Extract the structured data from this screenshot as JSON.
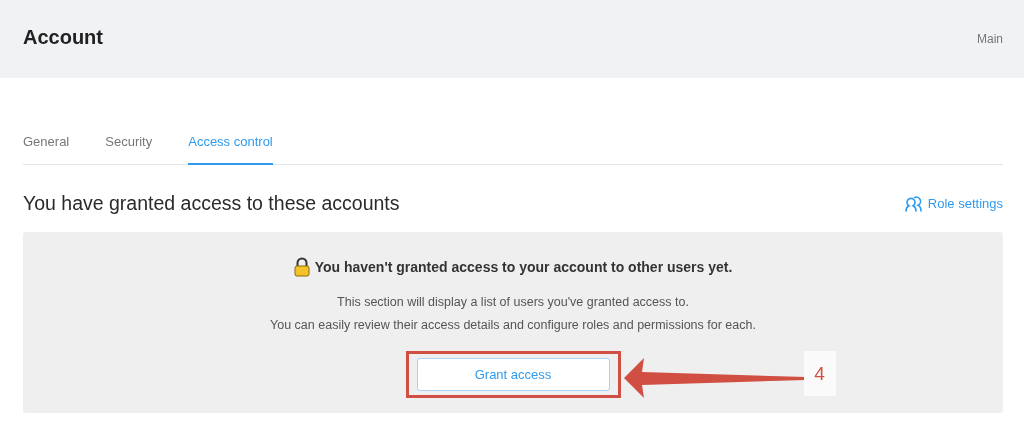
{
  "header": {
    "title": "Account",
    "breadcrumb": "Main"
  },
  "tabs": [
    {
      "label": "General",
      "selected": false
    },
    {
      "label": "Security",
      "selected": false
    },
    {
      "label": "Access control",
      "selected": true
    }
  ],
  "section": {
    "heading": "You have granted access to these accounts",
    "link": "Role settings"
  },
  "empty_state": {
    "title": "You haven't granted access to your account to other users yet.",
    "lines": [
      "This section will display a list of users you've granted access to.",
      "You can easily review their access details and configure roles and permissions for each."
    ],
    "button": "Grant access"
  },
  "annotation": {
    "label": "4"
  }
}
